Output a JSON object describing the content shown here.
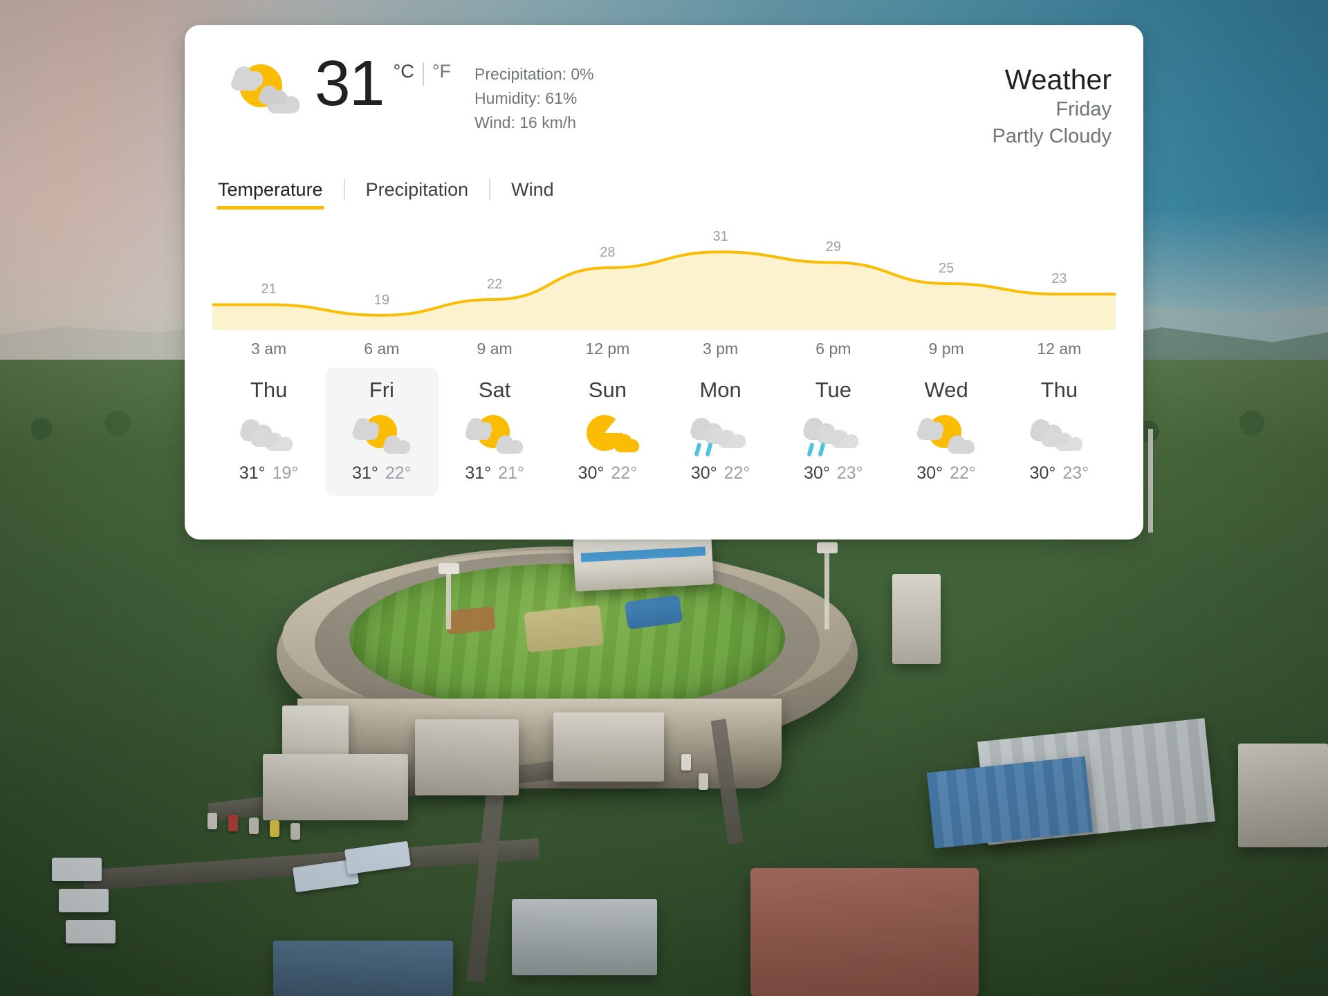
{
  "background": {
    "scene": "aerial-stadium-dusk",
    "description": "Aerial photograph of a cricket stadium surrounded by green hills and town at dusk"
  },
  "card": {
    "current": {
      "icon": "partly-cloudy-day-icon",
      "temperature": "31",
      "unit_celsius": "°C",
      "unit_separator": "|",
      "unit_fahrenheit": "°F",
      "precipitation": "Precipitation: 0%",
      "humidity": "Humidity: 61%",
      "wind": "Wind: 16 km/h"
    },
    "header": {
      "title": "Weather",
      "day": "Friday",
      "condition": "Partly Cloudy"
    },
    "tabs": [
      {
        "label": "Temperature",
        "active": true
      },
      {
        "label": "Precipitation",
        "active": false
      },
      {
        "label": "Wind",
        "active": false
      }
    ],
    "hours": [
      "3 am",
      "6 am",
      "9 am",
      "12 pm",
      "3 pm",
      "6 pm",
      "9 pm",
      "12 am"
    ],
    "days": [
      {
        "name": "Thu",
        "icon": "cloudy-icon",
        "high": "31°",
        "low": "19°",
        "selected": false
      },
      {
        "name": "Fri",
        "icon": "partly-cloudy-day-icon",
        "high": "31°",
        "low": "22°",
        "selected": true
      },
      {
        "name": "Sat",
        "icon": "partly-cloudy-day-icon",
        "high": "31°",
        "low": "21°",
        "selected": false
      },
      {
        "name": "Sun",
        "icon": "sunny-icon",
        "high": "30°",
        "low": "22°",
        "selected": false
      },
      {
        "name": "Mon",
        "icon": "rain-icon",
        "high": "30°",
        "low": "22°",
        "selected": false
      },
      {
        "name": "Tue",
        "icon": "rain-icon",
        "high": "30°",
        "low": "23°",
        "selected": false
      },
      {
        "name": "Wed",
        "icon": "partly-cloudy-day-icon",
        "high": "30°",
        "low": "22°",
        "selected": false
      },
      {
        "name": "Thu",
        "icon": "cloudy-icon",
        "high": "30°",
        "low": "23°",
        "selected": false
      }
    ]
  },
  "colors": {
    "accent": "#fbbc04",
    "area_fill": "#fdf2ce",
    "text_primary": "#202124",
    "text_secondary": "#70757a",
    "label_gray": "#9aa0a6",
    "cloud_gray": "#d5d5d5",
    "rain_blue": "#4fc3dc",
    "card_bg": "#ffffff",
    "selected_bg": "#f5f5f5"
  },
  "chart_data": {
    "type": "area",
    "title": "Temperature",
    "xlabel": "",
    "ylabel": "",
    "categories": [
      "3 am",
      "6 am",
      "9 am",
      "12 pm",
      "3 pm",
      "6 pm",
      "9 pm",
      "12 am"
    ],
    "values": [
      21,
      19,
      22,
      28,
      31,
      29,
      25,
      23
    ],
    "data_labels": [
      "21",
      "19",
      "22",
      "28",
      "31",
      "29",
      "25",
      "23"
    ],
    "ylim": [
      17,
      33
    ],
    "grid": false,
    "legend": "none",
    "line_color": "#fbbc04",
    "fill_color": "#fdf2ce",
    "unit": "°C"
  }
}
